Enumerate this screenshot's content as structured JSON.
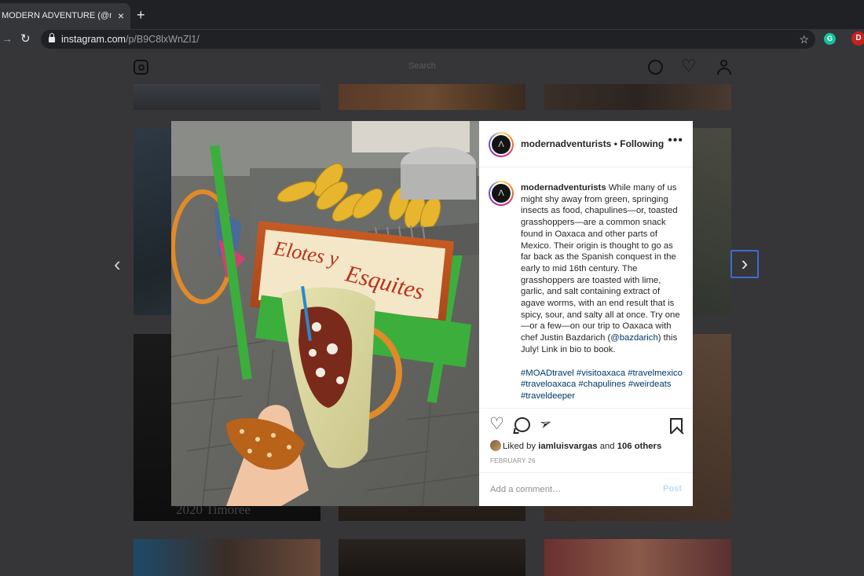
{
  "browser": {
    "tab_title": "MODERN ADVENTURE (@mod",
    "tab_close": "×",
    "new_tab": "+",
    "forward": "→",
    "reload": "↻",
    "url_host": "instagram.com",
    "url_path": "/p/B9C8lxWnZl1/",
    "star": "☆",
    "extension_label": "G",
    "profile_initial": "D"
  },
  "instagram_header": {
    "search_placeholder": "Search"
  },
  "grid": {
    "tile_caption": "2020 Timoree"
  },
  "navigation": {
    "prev": "‹",
    "next": "›"
  },
  "post": {
    "image_text": {
      "line1": "Elotes y",
      "line2": "Esquites"
    },
    "author": "modernadventurists",
    "separator": " • ",
    "follow_status": "Following",
    "more": "•••",
    "caption_body_1": " While many of us might shy away from green, springing insects as food, chapulines—or, toasted grasshoppers—are a common snack found in Oaxaca and other parts of Mexico. Their origin is thought to go as far back as the Spanish conquest in the early to mid 16th century. The grasshoppers are toasted with lime, garlic, and salt containing extract of agave worms, with an end result that is spicy, sour, and salty all at once. Try one—or a few—on our trip to Oaxaca with chef Justin Bazdarich (",
    "mention": "@bazdarich",
    "caption_body_2": ") this July! Link in bio to book.",
    "hashtags": "#MOADtravel #visitoaxaca #travelmexico #traveloaxaca #chapulines #weirdeats #traveldeeper",
    "liked_prefix": "Liked by ",
    "liked_user": "iamluisvargas",
    "liked_middle": " and ",
    "liked_others": "106 others",
    "date": "FEBRUARY 26",
    "comment_placeholder": "Add a comment…",
    "post_button": "Post"
  },
  "colors": {
    "link": "#00376b",
    "post_button_disabled": "#b9dffc",
    "focus_ring": "#3b6cd4"
  }
}
